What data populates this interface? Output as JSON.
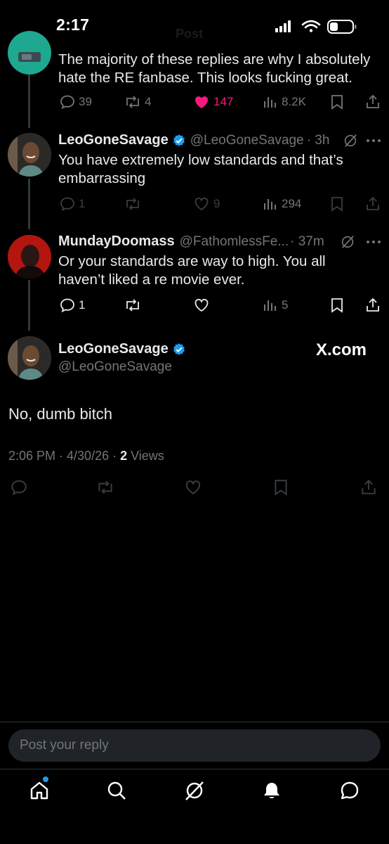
{
  "status_bar": {
    "time": "2:17",
    "header_ghost": "Post"
  },
  "tweets": [
    {
      "text": "The majority of these replies are why I absolutely hate the RE fanbase. This looks fucking great.",
      "replies": "39",
      "reposts": "4",
      "likes": "147",
      "views": "8.2K"
    },
    {
      "name": "LeoGoneSavage",
      "handle": "@LeoGoneSavage",
      "time": "· 3h",
      "text": "You have extremely low standards and that’s embarrassing",
      "replies": "1",
      "reposts": "",
      "likes": "9",
      "views": "294"
    },
    {
      "name": "MundayDoomass",
      "handle": "@FathomlessFe...",
      "time": "· 37m",
      "text": "Or your standards are way to high. You all haven’t liked a re movie ever.",
      "replies": "1",
      "reposts": "",
      "likes": "",
      "views": "5"
    }
  ],
  "main_tweet": {
    "name": "LeoGoneSavage",
    "handle": "@LeoGoneSavage",
    "text": "No, dumb bitch",
    "timestamp": "2:06 PM · 4/30/26 · ",
    "views_count": "2",
    "views_label": " Views",
    "watermark": "X.com"
  },
  "reply_box": {
    "placeholder": "Post your reply"
  },
  "colors": {
    "accent": "#1d9bf0",
    "like": "#f91880",
    "muted": "#71767b",
    "text": "#e7e9ea"
  },
  "icons": [
    "reply-icon",
    "repost-icon",
    "like-icon",
    "views-icon",
    "bookmark-icon",
    "share-icon",
    "grok-icon",
    "more-icon",
    "verified-icon",
    "home-icon",
    "search-icon",
    "notifications-icon",
    "messages-icon"
  ]
}
